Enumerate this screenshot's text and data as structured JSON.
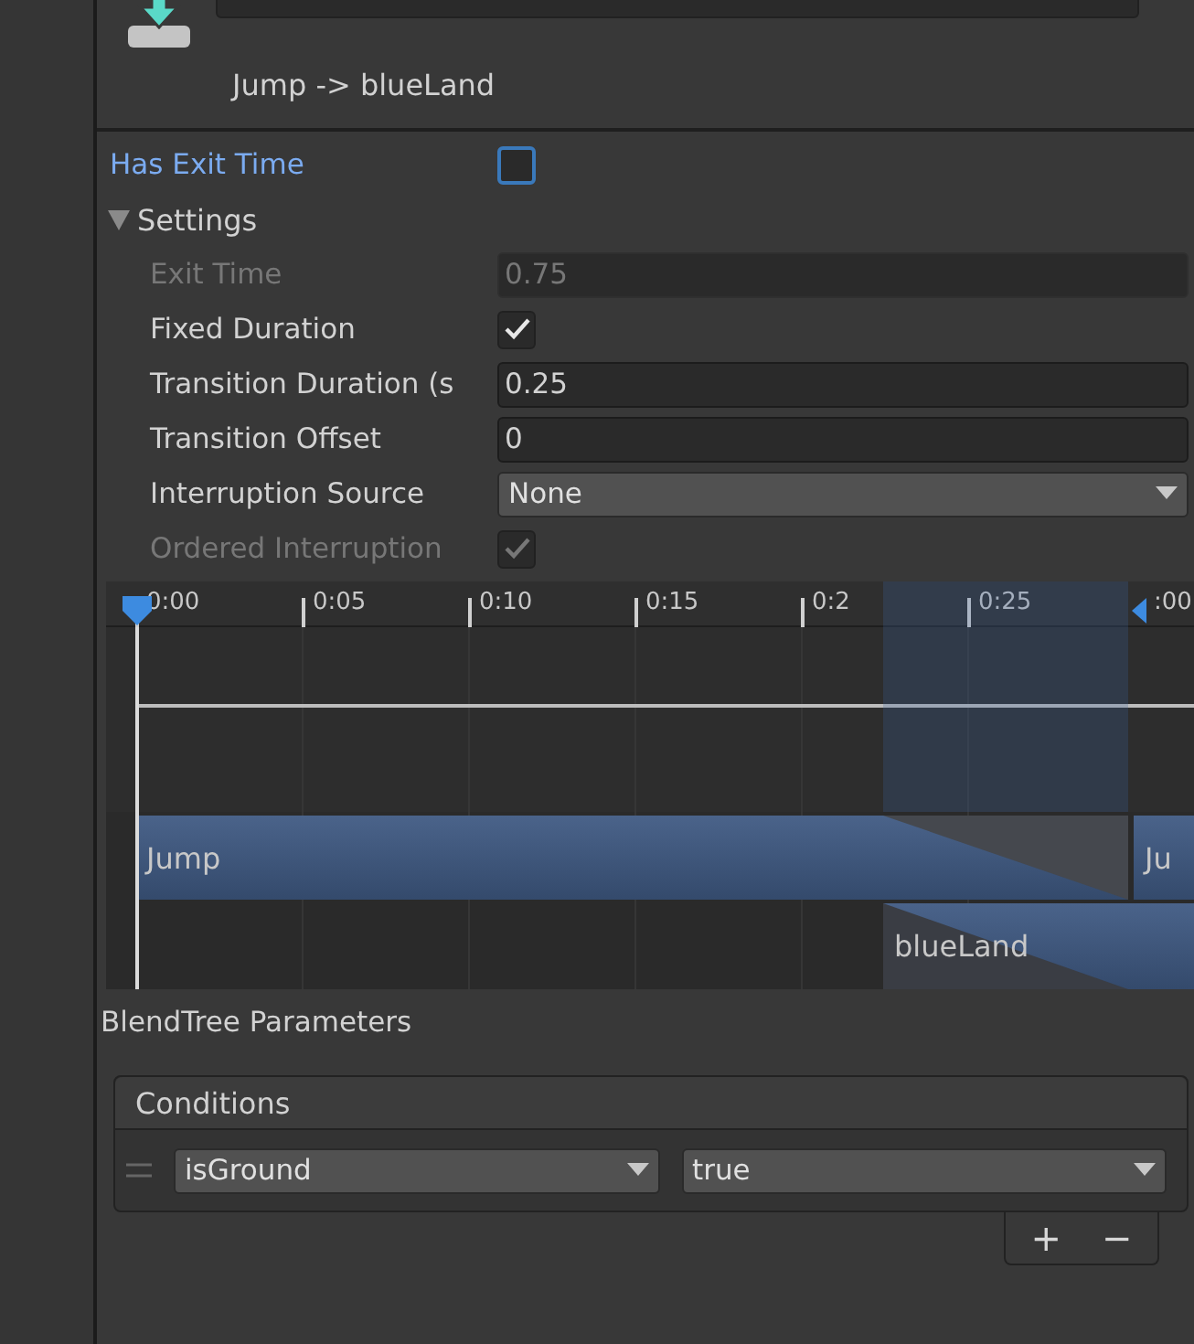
{
  "header": {
    "title": "Jump -> blueLand"
  },
  "has_exit_time": {
    "label": "Has Exit Time",
    "checked": false,
    "highlighted": true
  },
  "settings": {
    "label": "Settings",
    "expanded": true,
    "rows": [
      {
        "kind": "field",
        "label": "Exit Time",
        "value": "0.75",
        "disabled": true
      },
      {
        "kind": "checkbox",
        "label": "Fixed Duration",
        "checked": true,
        "disabled": false
      },
      {
        "kind": "field",
        "label": "Transition Duration (s",
        "value": "0.25",
        "disabled": false
      },
      {
        "kind": "field",
        "label": "Transition Offset",
        "value": "0",
        "disabled": false
      },
      {
        "kind": "dropdown",
        "label": "Interruption Source",
        "value": "None",
        "disabled": false
      },
      {
        "kind": "checkbox",
        "label": "Ordered Interruption",
        "checked": true,
        "disabled": true
      }
    ]
  },
  "timeline": {
    "ticks": [
      "0:00",
      "0:05",
      "0:10",
      "0:15",
      "0:2",
      "0:25",
      ":00"
    ],
    "clips": [
      {
        "name": "Jump"
      },
      {
        "name": "Ju"
      },
      {
        "name": "blueLand"
      }
    ]
  },
  "blendtree_label": "BlendTree Parameters",
  "conditions": {
    "title": "Conditions",
    "rows": [
      {
        "parameter": "isGround",
        "value": "true"
      }
    ],
    "add": "+",
    "remove": "−"
  }
}
